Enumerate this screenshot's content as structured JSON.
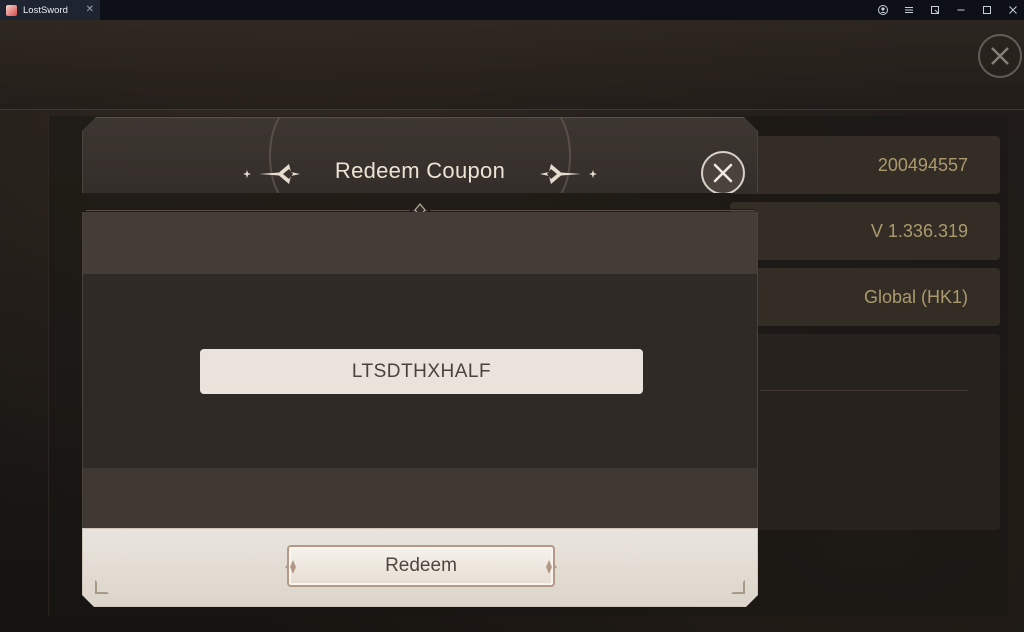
{
  "window": {
    "tab_title": "LostSword",
    "tab_close": "✕",
    "controls": [
      "account-icon",
      "menu-icon",
      "popout-icon",
      "minimize-icon",
      "maximize-icon",
      "close-icon"
    ]
  },
  "background": {
    "info_values": [
      "200494557",
      "V 1.336.319",
      "Global (HK1)"
    ]
  },
  "modal": {
    "title": "Redeem Coupon",
    "coupon_value": "LTSDTHXHALF",
    "redeem_label": "Redeem"
  },
  "colors": {
    "accent_gold": "#c9b580",
    "panel_dark": "#2f2a26",
    "footer_light": "#e9e4dd"
  }
}
